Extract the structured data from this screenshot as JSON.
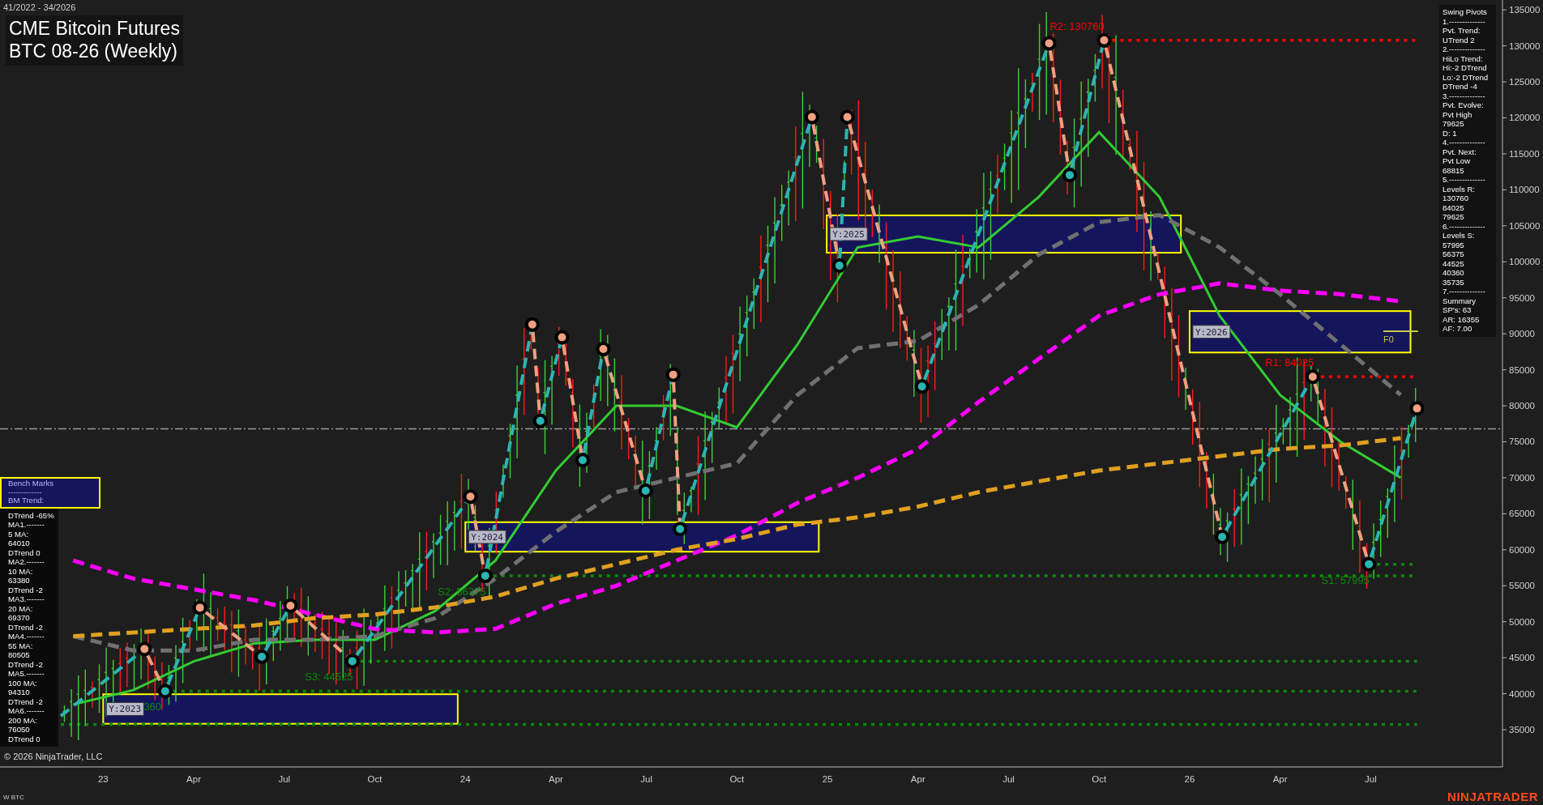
{
  "date_range": "41/2022 - 34/2026",
  "title_box": {
    "lines": [
      "CME Bitcoin Futures",
      "BTC 08-26 (Weekly)"
    ]
  },
  "swing_pivots_panel": {
    "lines": [
      "Swing Pivots",
      "1.--------------",
      "Pvt. Trend:",
      "UTrend 2",
      "2.--------------",
      "HiLo Trend:",
      "Hi:-2 DTrend",
      "Lo:-2 DTrend",
      "DTrend -4",
      "3.--------------",
      "Pvt. Evolve:",
      "Pvt High",
      "79625",
      "D: 1",
      "4.--------------",
      "Pvt. Next:",
      "Pvt Low",
      "68815",
      "5.--------------",
      "Levels R:",
      "130760",
      "84025",
      "79625",
      "6.--------------",
      "Levels S:",
      "57995",
      "56375",
      "44525",
      "40360",
      "35735",
      "7.--------------",
      "Summary",
      "SP's: 63",
      "AR: 16355",
      "AF: 7.00"
    ]
  },
  "bench_marks_panel": {
    "header_lines": [
      "Bench Marks",
      "-------------",
      "BM Trend:"
    ],
    "lines": [
      "DTrend -65%",
      "MA1.-------",
      "5 MA:",
      "64010",
      "DTrend 0",
      "MA2.-------",
      "10 MA:",
      "63380",
      "DTrend -2",
      "MA3.-------",
      "20 MA:",
      "69370",
      "DTrend -2",
      "MA4.-------",
      "55 MA:",
      "80505",
      "DTrend -2",
      "MA5.-------",
      "100 MA:",
      "94310",
      "DTrend -2",
      "MA6.-------",
      "200 MA:",
      "76050",
      "DTrend 0"
    ]
  },
  "chart_data": {
    "type": "line",
    "x": [
      2022.917,
      2023.083,
      2023.25,
      2023.417,
      2023.583,
      2023.75,
      2023.917,
      2024.083,
      2024.25,
      2024.417,
      2024.583,
      2024.75,
      2024.917,
      2025.083,
      2025.25,
      2025.417,
      2025.583,
      2025.75,
      2025.917,
      2026.083,
      2026.25,
      2026.417,
      2026.583
    ],
    "series": [
      {
        "color": "#33cc33",
        "line_style": "solid",
        "values": [
          38500,
          40500,
          44500,
          47000,
          47500,
          47500,
          51500,
          58500,
          71000,
          80000,
          80000,
          77000,
          88500,
          102000,
          103500,
          102000,
          109000,
          118000,
          109000,
          92500,
          81500,
          75000,
          70000
        ]
      },
      {
        "color": "#707070",
        "line_style": "dashed",
        "values": [
          48000,
          46000,
          46000,
          47500,
          47500,
          48000,
          50500,
          56000,
          62500,
          68000,
          70000,
          72000,
          81500,
          88000,
          89000,
          94000,
          101000,
          105500,
          106500,
          102000,
          95500,
          88500,
          81500
        ]
      },
      {
        "color": "#ff00ff",
        "line_style": "dashed",
        "values": [
          58500,
          56000,
          54500,
          53000,
          51000,
          49000,
          48500,
          49000,
          52500,
          55000,
          58500,
          62000,
          66500,
          70000,
          74000,
          80500,
          86500,
          92500,
          95500,
          97000,
          96000,
          95500,
          94500
        ]
      },
      {
        "color": "#e0a020",
        "line_style": "dashed",
        "values": [
          48000,
          48500,
          49000,
          49500,
          50500,
          51000,
          52000,
          53500,
          56000,
          58000,
          60000,
          61500,
          63500,
          64500,
          66000,
          68000,
          69500,
          71000,
          72000,
          73000,
          74000,
          74500,
          75500
        ]
      }
    ],
    "xlim": [
      2022.715,
      2026.864
    ],
    "ylim": [
      29830,
      136366
    ],
    "yticks": [
      135000,
      130000,
      125000,
      120000,
      115000,
      110000,
      105000,
      100000,
      95000,
      90000,
      85000,
      80000,
      75000,
      70000,
      65000,
      60000,
      55000,
      50000,
      45000,
      40000,
      35000
    ],
    "xticks": [
      {
        "value": 2023,
        "label": "23"
      },
      {
        "value": 2023.25,
        "label": "Apr"
      },
      {
        "value": 2023.5,
        "label": "Jul"
      },
      {
        "value": 2023.75,
        "label": "Oct"
      },
      {
        "value": 2024,
        "label": "24"
      },
      {
        "value": 2024.25,
        "label": "Apr"
      },
      {
        "value": 2024.5,
        "label": "Jul"
      },
      {
        "value": 2024.75,
        "label": "Oct"
      },
      {
        "value": 2025,
        "label": "25"
      },
      {
        "value": 2025.25,
        "label": "Apr"
      },
      {
        "value": 2025.5,
        "label": "Jul"
      },
      {
        "value": 2025.75,
        "label": "Oct"
      },
      {
        "value": 2026,
        "label": "26"
      },
      {
        "value": 2026.25,
        "label": "Apr"
      },
      {
        "value": 2026.5,
        "label": "Jul"
      }
    ]
  },
  "overlays": {
    "zones": [
      {
        "label": "Y:2023"
      },
      {
        "label": "Y:2024"
      },
      {
        "label": "Y:2025"
      },
      {
        "label": "Y:2026"
      }
    ],
    "marker": {
      "label": "F0"
    },
    "levels": [
      {
        "kind": "resistance",
        "label": "R2: 130760"
      },
      {
        "kind": "resistance",
        "label": "R1: 84025"
      },
      {
        "kind": "support",
        "label": "S1: 57995"
      },
      {
        "kind": "support",
        "label": "S2: 56375"
      },
      {
        "kind": "support",
        "label": "S3: 44525"
      },
      {
        "kind": "support",
        "label": "360"
      },
      {
        "kind": "support"
      }
    ]
  },
  "copyright": "© 2026 NinjaTrader, LLC",
  "instrument_label": "W BTC",
  "logo": "NINJATRADER"
}
